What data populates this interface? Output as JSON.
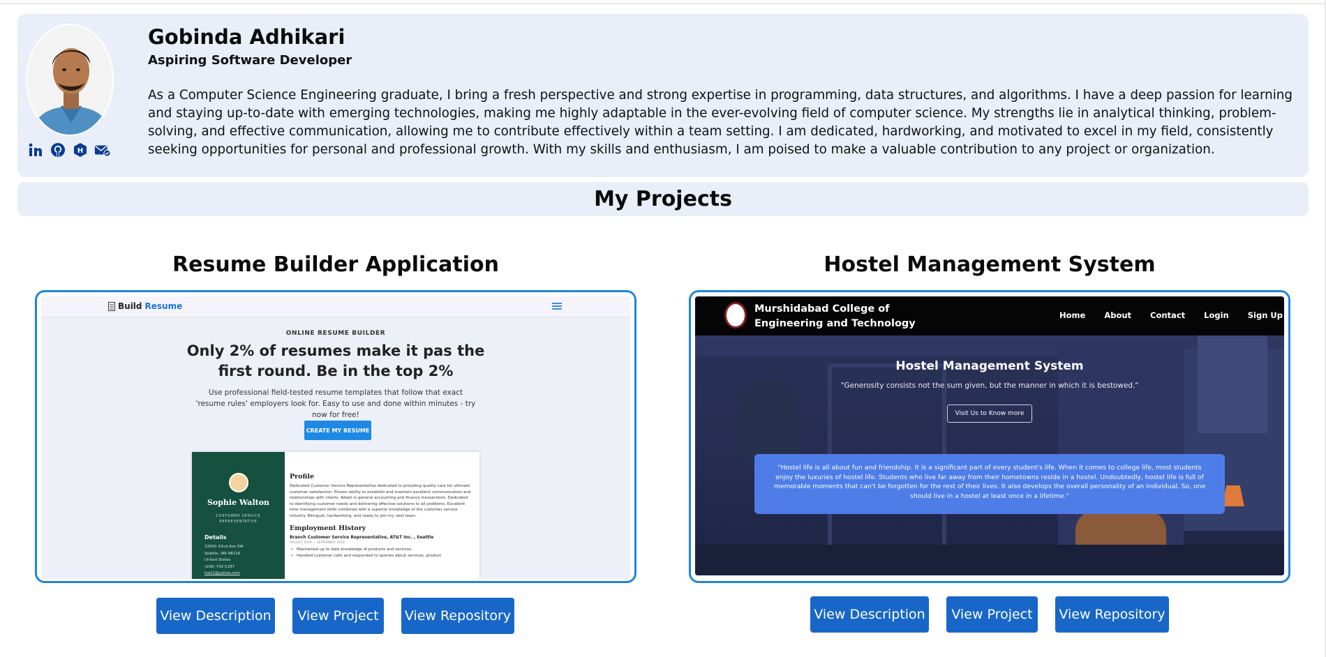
{
  "profile": {
    "name": "Gobinda Adhikari",
    "role": "Aspiring Software Developer",
    "bio": "As a Computer Science Engineering graduate, I bring a fresh perspective and strong expertise in programming, data structures, and algorithms. I have a deep passion for learning and staying up-to-date with emerging technologies, making me highly adaptable in the ever-evolving field of computer science. My strengths lie in analytical thinking, problem-solving, and effective communication, allowing me to contribute effectively within a team setting. I am dedicated, hardworking, and motivated to excel in my field, consistently seeking opportunities for personal and professional growth. With my skills and enthusiasm, I am poised to make a valuable contribution to any project or organization.",
    "socials": [
      "linkedin-icon",
      "github-icon",
      "hashnode-icon",
      "mail-icon"
    ]
  },
  "section": {
    "title": "My Projects"
  },
  "projects": [
    {
      "title": "Resume Builder Application",
      "buttons": [
        "View Description",
        "View Project",
        "View Repository"
      ],
      "preview": {
        "logo_a": "Build",
        "logo_b": "Resume",
        "kicker": "ONLINE RESUME BUILDER",
        "headline": "Only 2% of resumes make it pas the first round. Be in the top 2%",
        "subtext": "Use professional field-tested resume templates that follow that exact 'resume rules' employers look for. Easy to use and done within minutes - try now for free!",
        "cta": "CREATE MY RESUME",
        "resume": {
          "name": "Sophie Walton",
          "title": "CUSTOMER SERVICE REPRESENTATIVE",
          "details_heading": "Details",
          "details": [
            "32600 42nd Ave SW",
            "Seattle, WA 98116",
            "United States",
            "(206) 742-5187",
            "hw12@yahoo.com"
          ],
          "profile_heading": "Profile",
          "profile_text": "Dedicated Customer Service Representative dedicated to providing quality care for ultimate customer satisfaction. Proven ability to establish and maintain excellent communication and relationships with clients. Adept in general accounting and finance transactions. Dedicated to identifying customer needs and delivering effective solutions to all problems. Excellent time management skills combined with a superior knowledge of the customer service industry. Bilingual, hardworking, and ready to join my next team.",
          "history_heading": "Employment History",
          "job": "Branch Customer Service Representative, AT&T Inc. , Seattle",
          "job_dates": "AUGUST 2019 — SEPTEMBER 2019",
          "bullets": [
            "Maintained up to date knowledge of products and services.",
            "Handled customer calls and responded to queries about services, product"
          ]
        }
      }
    },
    {
      "title": "Hostel Management System",
      "buttons": [
        "View Description",
        "View Project",
        "View Repository"
      ],
      "preview": {
        "brand_line1": "Murshidabad College of",
        "brand_line2": "Engineering and Technology",
        "nav": [
          "Home",
          "About",
          "Contact",
          "Login",
          "Sign Up"
        ],
        "title": "Hostel Management System",
        "quote": "\"Generosity consists not the sum given, but the manner in which it is bestowed.\"",
        "visit": "Visit Us to Know more",
        "box_text": "\"Hostel life is all about fun and friendship. It is a significant part of every student's life. When it comes to college life, most students enjoy the luxuries of hostel life. Students who live far away from their hometowns reside in a hostel. Undoubtedly, hostel life is full of memorable moments that can't be forgotten for the rest of their lives. It also develops the overall personality of an individual. So, one should live in a hostel at least once in a lifetime.\""
      }
    }
  ],
  "colors": {
    "card_bg": "#e9eef8",
    "accent_border": "#1f86d6",
    "button_bg": "#1867c8",
    "resume_sidebar": "#16503e",
    "hostel_box": "#4e7de8"
  }
}
